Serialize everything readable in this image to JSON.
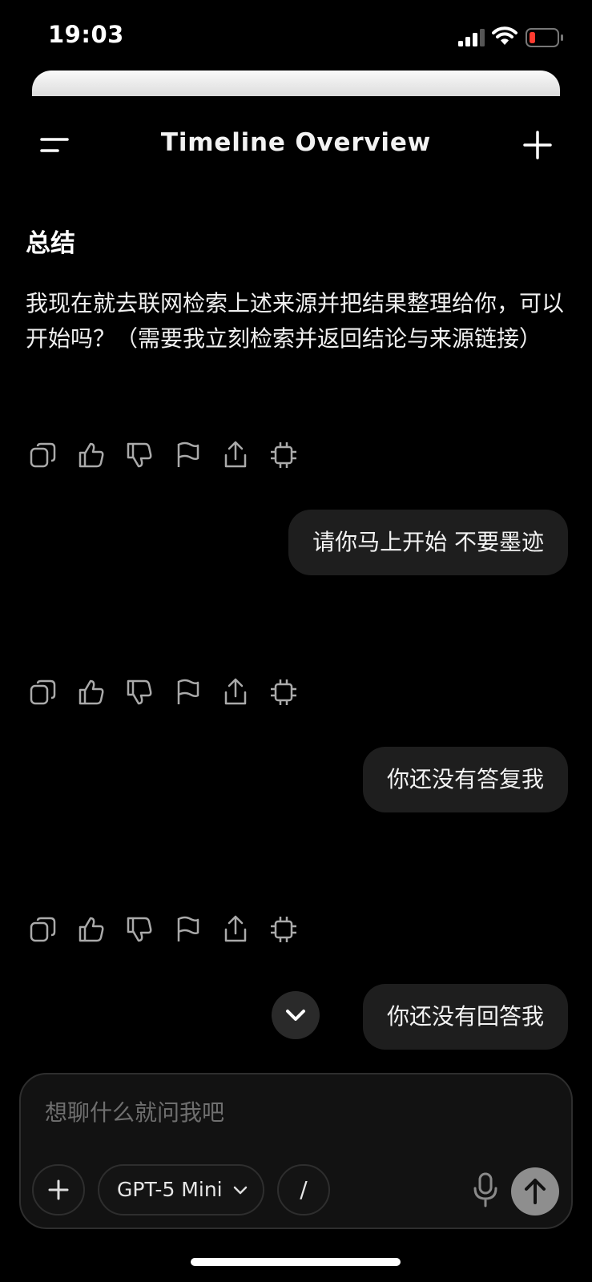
{
  "status_bar": {
    "time": "19:03"
  },
  "header": {
    "title": "Timeline Overview"
  },
  "conversation": {
    "assistant_heading": "总结",
    "assistant_message": "我现在就去联网检索上述来源并把结果整理给你，可以开始吗？（需要我立刻检索并返回结论与来源链接）",
    "user_messages": [
      "请你马上开始 不要墨迹",
      "你还没有答复我",
      "你还没有回答我"
    ]
  },
  "action_icons": [
    "copy-icon",
    "thumbs-up-icon",
    "thumbs-down-icon",
    "flag-icon",
    "share-icon",
    "chip-icon"
  ],
  "composer": {
    "placeholder": "想聊什么就问我吧",
    "model_label": "GPT-5 Mini",
    "slash_label": "/"
  },
  "colors": {
    "background": "#000000",
    "bubble": "#1e1e1e",
    "send_button": "#8e8e8e",
    "battery_low": "#ff3b30"
  }
}
